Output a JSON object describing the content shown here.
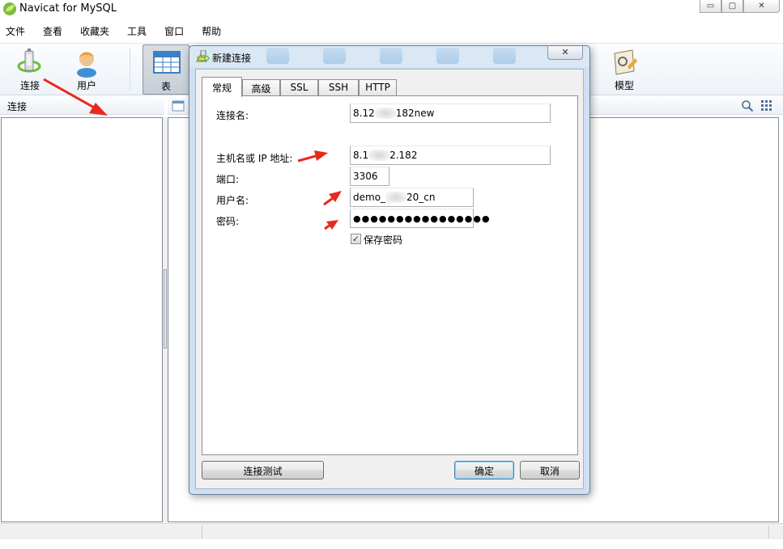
{
  "window": {
    "title": "Navicat for MySQL",
    "min_glyph": "▭",
    "max_glyph": "▢",
    "close_glyph": "✕"
  },
  "menu": [
    "文件",
    "查看",
    "收藏夹",
    "工具",
    "窗口",
    "帮助"
  ],
  "toolbar": {
    "connect_label": "连接",
    "user_label": "用户",
    "table_label": "表",
    "model_label": "模型"
  },
  "connections_pane": {
    "title": "连接"
  },
  "dialog": {
    "title": "新建连接",
    "close_glyph": "✕",
    "tabs": [
      "常规",
      "高级",
      "SSL",
      "SSH",
      "HTTP"
    ],
    "active_tab": "常规",
    "fields": {
      "connection_name": {
        "label": "连接名:",
        "value_prefix": "8.12",
        "value_suffix": "182new"
      },
      "host": {
        "label": "主机名或 IP 地址:",
        "value_prefix": "8.1",
        "value_suffix": "2.182"
      },
      "port": {
        "label": "端口:",
        "value": "3306"
      },
      "username": {
        "label": "用户名:",
        "value_prefix": "demo_",
        "value_suffix": "20_cn"
      },
      "password": {
        "label": "密码:",
        "value": "●●●●●●●●●●●●●●●●"
      }
    },
    "save_password": {
      "label": "保存密码",
      "checked": true,
      "glyph": "✓"
    },
    "buttons": {
      "test": "连接测试",
      "ok": "确定",
      "cancel": "取消"
    }
  },
  "colors": {
    "annotation_arrow": "#e8291c",
    "dialog_frame": "#cfe0f2",
    "default_button_border": "#3c7fb1"
  },
  "icons": [
    "navicat-leaf-icon",
    "connection-plug-icon",
    "user-person-icon",
    "table-grid-icon",
    "model-icon",
    "search-icon",
    "grid-view-icon",
    "new-connection-wizard-icon"
  ]
}
